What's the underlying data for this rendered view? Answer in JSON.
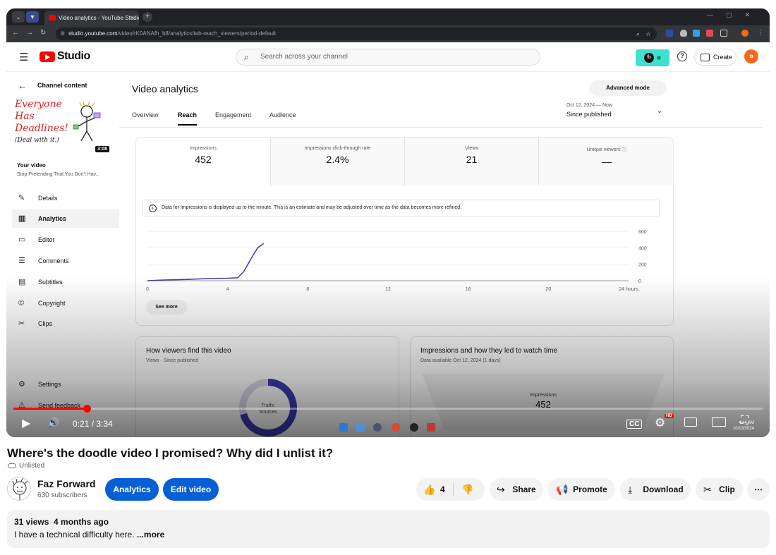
{
  "browser": {
    "tab_title": "Video analytics - YouTube Studio",
    "url_host": "studio.youtube.com",
    "url_path": "/video/rK0ANAfh_b8/analytics/tab-reach_viewers/period-default"
  },
  "studio": {
    "logo_text": "Studio",
    "search_placeholder": "Search across your channel",
    "ext_badge": "fb",
    "create_label": "Create"
  },
  "sidebar": {
    "back_label": "Channel content",
    "thumb_lines": [
      "Everyone",
      "Has",
      "Deadlines!",
      "(Deal with it.)"
    ],
    "thumb_duration": "3:08",
    "your_video_label": "Your video",
    "video_title": "Stop Pretending That You Don't Hav...",
    "items": [
      {
        "label": "Details",
        "icon": "pencil-icon",
        "glyph": "✎",
        "active": false
      },
      {
        "label": "Analytics",
        "icon": "analytics-icon",
        "glyph": "▥",
        "active": true
      },
      {
        "label": "Editor",
        "icon": "editor-icon",
        "glyph": "▭",
        "active": false
      },
      {
        "label": "Comments",
        "icon": "comments-icon",
        "glyph": "☰",
        "active": false
      },
      {
        "label": "Subtitles",
        "icon": "subtitles-icon",
        "glyph": "▤",
        "active": false
      },
      {
        "label": "Copyright",
        "icon": "copyright-icon",
        "glyph": "©",
        "active": false
      },
      {
        "label": "Clips",
        "icon": "scissors-icon",
        "glyph": "✂",
        "active": false
      }
    ],
    "settings_label": "Settings",
    "feedback_label": "Send feedback"
  },
  "analytics": {
    "title": "Video analytics",
    "advanced_label": "Advanced mode",
    "tabs": [
      {
        "label": "Overview",
        "active": false
      },
      {
        "label": "Reach",
        "active": true
      },
      {
        "label": "Engagement",
        "active": false
      },
      {
        "label": "Audience",
        "active": false
      }
    ],
    "date_range": "Oct 12, 2024 — Now",
    "date_label": "Since published",
    "metrics": [
      {
        "label": "Impressions",
        "value": "452"
      },
      {
        "label": "Impressions click-through rate",
        "value": "2.4%"
      },
      {
        "label": "Views",
        "value": "21"
      },
      {
        "label": "Unique viewers",
        "value": "—"
      }
    ],
    "notice": "Data for Impressions is displayed up to the minute. This is an estimate and may be adjusted over time as the data becomes more refined.",
    "see_more": "See more",
    "card1_title": "How viewers find this video",
    "card1_sub": "Views · Since published",
    "donut_label_1": "Traffic",
    "donut_label_2": "Sources",
    "card2_title": "Impressions and how they led to watch time",
    "card2_sub": "Data available Oct 12, 2024 (1 days)",
    "funnel_label": "Impressions",
    "funnel_value": "452"
  },
  "chart_data": {
    "type": "line",
    "x": [
      0,
      0.5,
      1,
      1.5,
      2,
      2.5,
      3,
      3.5,
      4,
      4.5,
      4.8,
      5.2,
      5.5,
      5.8
    ],
    "values": [
      0,
      5,
      10,
      12,
      15,
      20,
      25,
      28,
      30,
      35,
      110,
      280,
      400,
      452
    ],
    "x_ticks": [
      "0",
      "4",
      "8",
      "12",
      "16",
      "20",
      "24 hours"
    ],
    "y_ticks": [
      "600",
      "400",
      "200",
      "0"
    ],
    "xlim": [
      0,
      24
    ],
    "ylim": [
      0,
      600
    ]
  },
  "player": {
    "current_time": "0:21",
    "duration": "3:34",
    "time_display": "0:21 / 3:34",
    "progress": 0.098,
    "quality_badge": "HD",
    "clock_time": "4:44 AM",
    "clock_date": "10/13/2024"
  },
  "watch": {
    "title": "Where's the doodle video I promised? Why did I unlist it?",
    "visibility": "Unlisted",
    "channel_name": "Faz Forward",
    "subscribers": "630 subscribers",
    "analytics_btn": "Analytics",
    "edit_btn": "Edit video",
    "like_count": "4",
    "share_label": "Share",
    "promote_label": "Promote",
    "download_label": "Download",
    "clip_label": "Clip",
    "views": "31 views",
    "age": "4 months ago",
    "description": "I have a technical difficulty here.",
    "more_label": "...more"
  }
}
